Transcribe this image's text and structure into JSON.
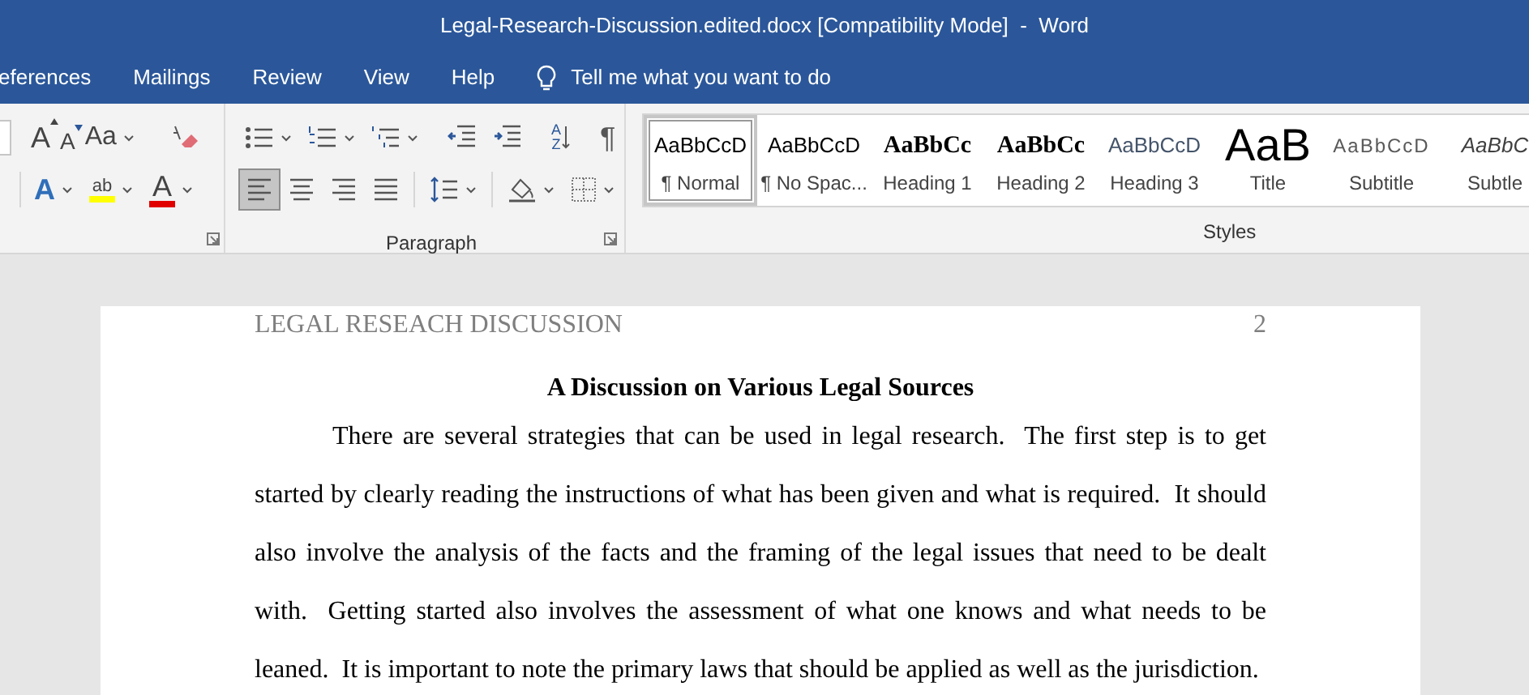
{
  "window": {
    "title": "Legal-Research-Discussion.edited.docx [Compatibility Mode]  -  Word"
  },
  "menu_tabs": [
    {
      "label": "eferences",
      "selected": false
    },
    {
      "label": "Mailings",
      "selected": false
    },
    {
      "label": "Review",
      "selected": false
    },
    {
      "label": "View",
      "selected": false
    },
    {
      "label": "Help",
      "selected": false
    }
  ],
  "tell_me": {
    "placeholder": "Tell me what you want to do"
  },
  "font_group": {
    "row1": [
      {
        "kind": "grow",
        "label": "A",
        "dropdown": false
      },
      {
        "kind": "shrink",
        "label": "A",
        "dropdown": false
      },
      {
        "kind": "change_case",
        "label": "Aa",
        "dropdown": true
      },
      {
        "kind": "clear_formatting",
        "dropdown": false
      }
    ],
    "row2": [
      {
        "kind": "text_effects",
        "label": "A",
        "dropdown": true
      },
      {
        "kind": "highlight",
        "label": "ab",
        "dropdown": true
      },
      {
        "kind": "font_color",
        "label": "A",
        "dropdown": true
      }
    ]
  },
  "paragraph_group": {
    "label": "Paragraph",
    "row1": [
      {
        "kind": "bullets",
        "dropdown": true
      },
      {
        "kind": "numbering",
        "dropdown": true
      },
      {
        "kind": "multilevel",
        "dropdown": true
      },
      {
        "kind": "decrease_indent",
        "dropdown": false
      },
      {
        "kind": "increase_indent",
        "dropdown": false
      },
      {
        "kind": "sort",
        "label": "AZ",
        "dropdown": false
      },
      {
        "kind": "show_marks",
        "label": "¶",
        "dropdown": false
      }
    ],
    "row2": [
      {
        "kind": "align_left",
        "selected": true,
        "dropdown": false
      },
      {
        "kind": "align_center",
        "selected": false,
        "dropdown": false
      },
      {
        "kind": "align_right",
        "selected": false,
        "dropdown": false
      },
      {
        "kind": "justify",
        "selected": false,
        "dropdown": false
      },
      {
        "kind": "line_spacing",
        "selected": false,
        "dropdown": true
      },
      {
        "kind": "shading",
        "selected": false,
        "dropdown": true
      },
      {
        "kind": "borders",
        "selected": false,
        "dropdown": true
      }
    ]
  },
  "styles": {
    "label": "Styles",
    "items": [
      {
        "preview": "AaBbCcD",
        "name": "¶ Normal",
        "kind": "normal",
        "selected": true
      },
      {
        "preview": "AaBbCcD",
        "name": "¶ No Spac...",
        "kind": "normal",
        "selected": false
      },
      {
        "preview": "AaBbCc",
        "name": "Heading 1",
        "kind": "heading",
        "selected": false
      },
      {
        "preview": "AaBbCc",
        "name": "Heading 2",
        "kind": "heading",
        "selected": false
      },
      {
        "preview": "AaBbCcD",
        "name": "Heading 3",
        "kind": "heading3",
        "selected": false
      },
      {
        "preview": "AaB",
        "name": "Title",
        "kind": "title",
        "selected": false
      },
      {
        "preview": "AaBbCcD",
        "name": "Subtitle",
        "kind": "subtitle",
        "selected": false
      },
      {
        "preview": "AaBbC",
        "name": "Subtle",
        "kind": "emphasis",
        "selected": false
      }
    ]
  },
  "document": {
    "header": "LEGAL RESEACH DISCUSSION",
    "page_number": "2",
    "heading": "A Discussion on Various Legal Sources",
    "paragraph": "There are several strategies that can be used in legal research.  The first step is to get started by clearly reading the instructions of what has been given and what is required.  It should also involve the analysis of the facts and the framing of the legal issues that need to be dealt with.  Getting started also involves the assessment of what one knows and what needs to be leaned.  It is important to note the primary laws that should be applied as well as the jurisdiction."
  }
}
